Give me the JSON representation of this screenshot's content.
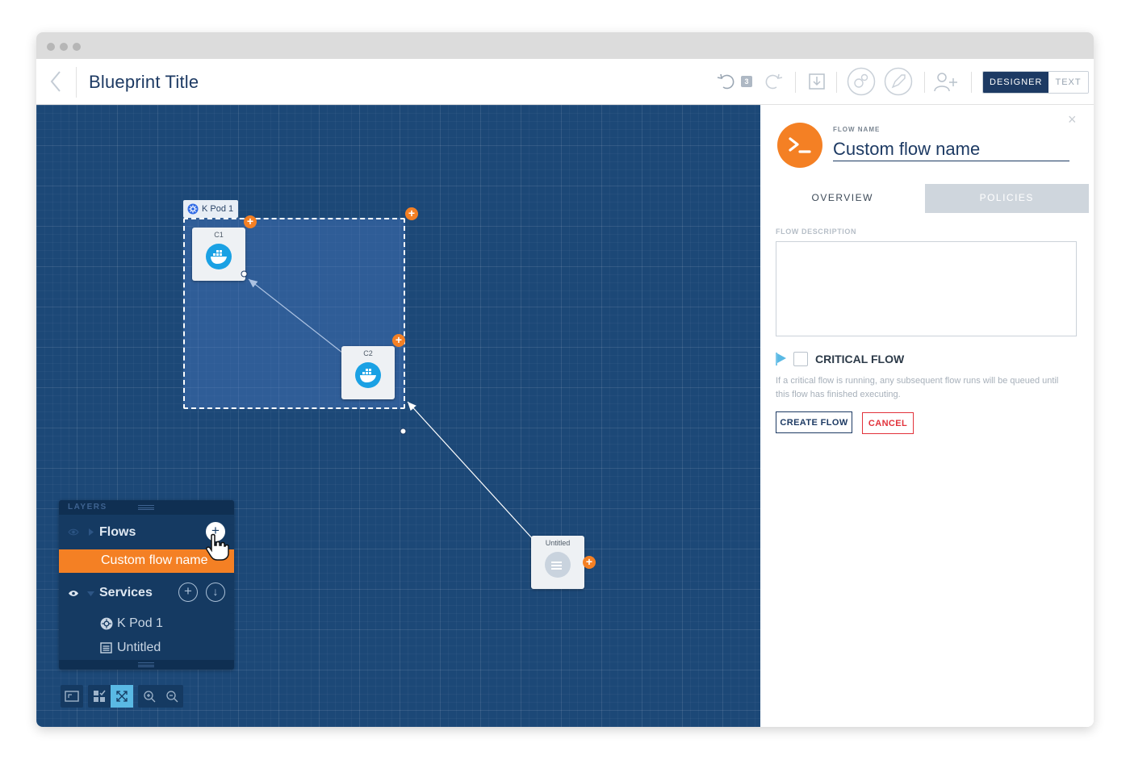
{
  "header": {
    "title": "Blueprint Title",
    "undo_count": "3",
    "mode_designer": "DESIGNER",
    "mode_text": "TEXT"
  },
  "canvas": {
    "pod": {
      "label": "K Pod 1"
    },
    "nodes": [
      {
        "label": "C1",
        "icon": "docker-icon"
      },
      {
        "label": "C2",
        "icon": "docker-icon"
      },
      {
        "label": "Untitled",
        "icon": "generic-service-icon"
      }
    ],
    "plus_symbol": "+"
  },
  "layers": {
    "title": "LAYERS",
    "flows_label": "Flows",
    "flow_items": [
      "Custom flow name"
    ],
    "services_label": "Services",
    "service_items": [
      "K Pod 1",
      "Untitled"
    ],
    "add_symbol": "+",
    "down_symbol": "↓"
  },
  "panel": {
    "flow_name_label": "FLOW NAME",
    "flow_name_value": "Custom flow name",
    "tabs": [
      "OVERVIEW",
      "POLICIES"
    ],
    "active_tab": "OVERVIEW",
    "description_label": "FLOW DESCRIPTION",
    "description_value": "",
    "critical_label": "CRITICAL FLOW",
    "critical_checked": false,
    "critical_help": "If a critical flow is running, any subsequent flow runs will be queued until this flow has finished executing.",
    "create_button": "CREATE FLOW",
    "cancel_button": "CANCEL",
    "close_symbol": "×"
  },
  "colors": {
    "accent_orange": "#f48024",
    "navy": "#1d3a63",
    "canvas_blue": "#1c4877",
    "docker_blue": "#2496ed",
    "cancel_red": "#e2323b"
  }
}
